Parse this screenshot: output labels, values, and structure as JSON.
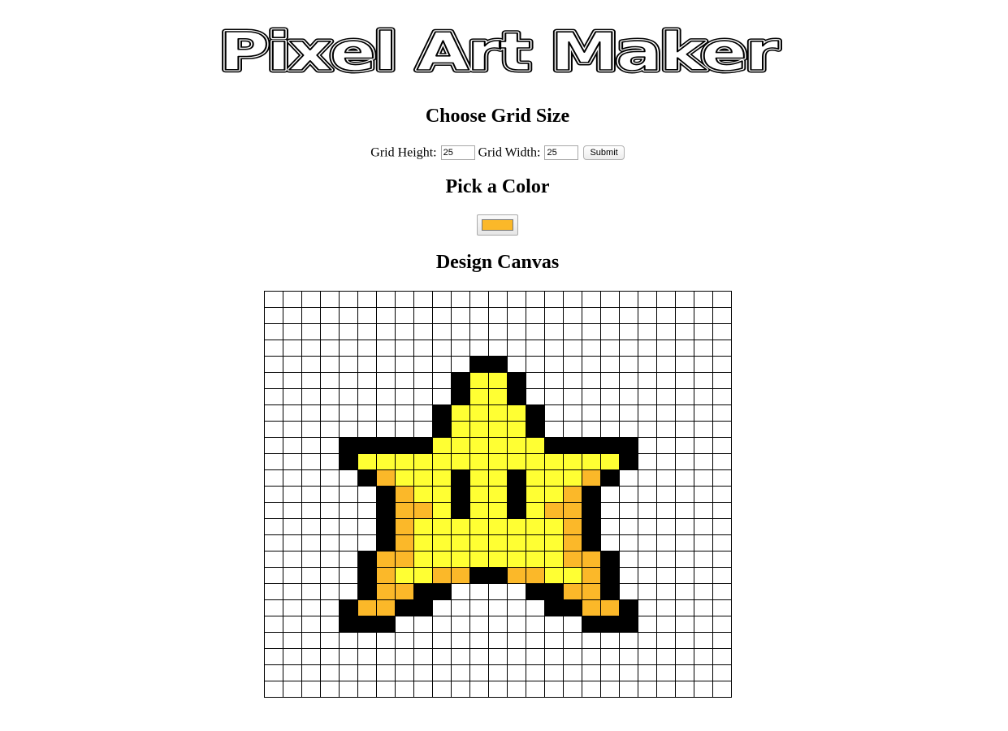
{
  "header": {
    "title": "Pixel Art Maker"
  },
  "grid_size_section": {
    "heading": "Choose Grid Size",
    "height_label": "Grid Height:",
    "height_value": "25",
    "width_label": "Grid Width:",
    "width_value": "25",
    "submit_label": "Submit"
  },
  "color_section": {
    "heading": "Pick a Color",
    "selected_color": "#fbb829"
  },
  "canvas_section": {
    "heading": "Design Canvas",
    "rows": 25,
    "cols": 25,
    "palette": {
      ".": "#ffffff",
      "K": "#000000",
      "Y": "#ffff33",
      "O": "#fbb829"
    },
    "pixels": [
      ".........................",
      ".........................",
      ".........................",
      ".........................",
      "...........KK............",
      "..........KYYK...........",
      "..........KYYK...........",
      ".........KYYYYK..........",
      ".........KYYYYK..........",
      "....KKKKKYYYYYYKKKKK.....",
      "....KYYYYYYYYYYYYYYK.....",
      ".....KOYYYKYYKYYYOK......",
      "......KOYYKYYKYYOK.......",
      "......KOOYKYYKYOOK.......",
      "......KOYYYYYYYYOK.......",
      "......KOYYYYYYYYOK.......",
      ".....KOOYYYYYYYYOOK......",
      ".....KOYYOOKKOOYYOK......",
      ".....KOOKK....KKOOK......",
      "....KOOKK......KKOOK.....",
      "....KKK..........KKK.....",
      ".........................",
      ".........................",
      ".........................",
      "........................."
    ]
  }
}
